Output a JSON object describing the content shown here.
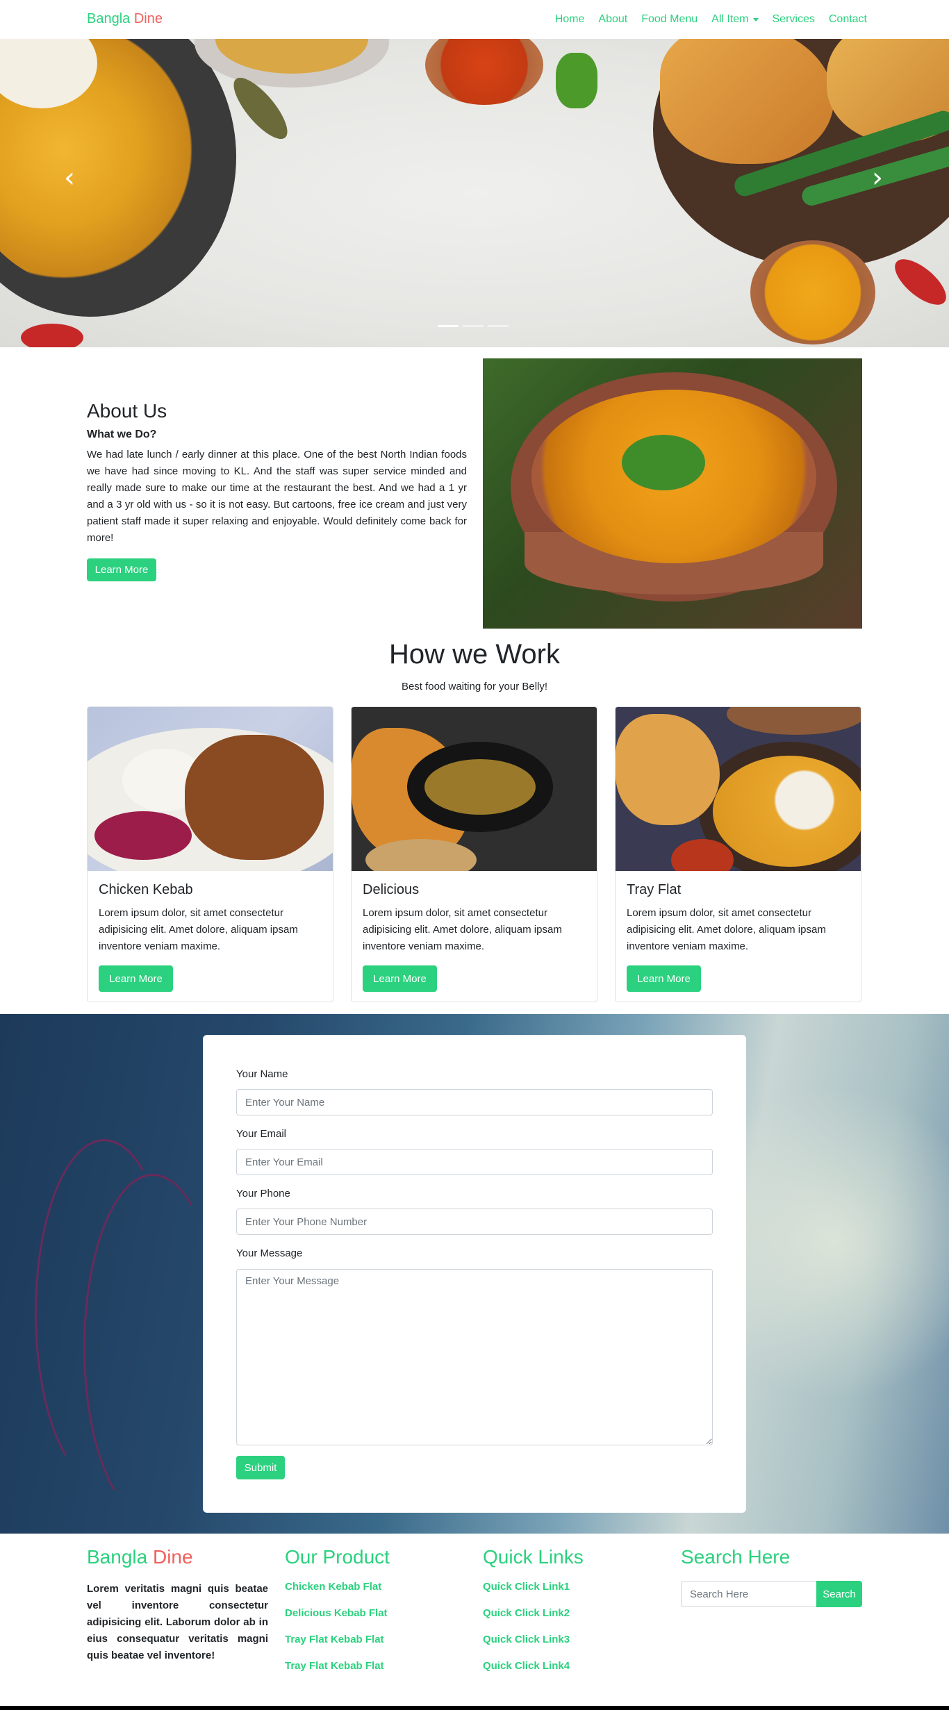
{
  "navbar": {
    "brand_part1": "Bangla",
    "brand_part2": "Dine",
    "items": [
      "Home",
      "About",
      "Food Menu",
      "All Item",
      "Services",
      "Contact"
    ]
  },
  "hero": {
    "prev_icon": "chevron-left-icon",
    "next_icon": "chevron-right-icon",
    "slide_count": 3,
    "active_slide": 1
  },
  "about": {
    "title": "About Us",
    "subtitle": "What we Do?",
    "text": "We had late lunch / early dinner at this place. One of the best North Indian foods we have had since moving to KL. And the staff was super service minded and really made sure to make our time at the restaurant the best. And we had a 1 yr and a 3 yr old with us - so it is not easy. But cartoons, free ice cream and just very patient staff made it super relaxing and enjoyable. Would definitely come back for more!",
    "button": "Learn More"
  },
  "how": {
    "title": "How we Work",
    "subtitle": "Best food waiting for your Belly!",
    "cards": [
      {
        "title": "Chicken Kebab",
        "text": "Lorem ipsum dolor, sit amet consectetur adipisicing elit. Amet dolore, aliquam ipsam inventore veniam maxime.",
        "button": "Learn More"
      },
      {
        "title": "Delicious",
        "text": "Lorem ipsum dolor, sit amet consectetur adipisicing elit. Amet dolore, aliquam ipsam inventore veniam maxime.",
        "button": "Learn More"
      },
      {
        "title": "Tray Flat",
        "text": "Lorem ipsum dolor, sit amet consectetur adipisicing elit. Amet dolore, aliquam ipsam inventore veniam maxime.",
        "button": "Learn More"
      }
    ]
  },
  "contact": {
    "name_label": "Your Name",
    "name_placeholder": "Enter Your Name",
    "email_label": "Your Email",
    "email_placeholder": "Enter Your Email",
    "phone_label": "Your Phone",
    "phone_placeholder": "Enter Your Phone Number",
    "message_label": "Your Message",
    "message_placeholder": "Enter Your Message",
    "submit": "Submit"
  },
  "footer": {
    "brand_part1": "Bangla",
    "brand_part2": "Dine",
    "text": "Lorem veritatis magni quis beatae vel inventore consectetur adipisicing elit. Laborum dolor ab in eius consequatur veritatis magni quis beatae vel inventore!",
    "product_title": "Our Product",
    "products": [
      "Chicken Kebab Flat",
      "Delicious Kebab Flat",
      "Tray Flat Kebab Flat",
      "Tray Flat Kebab Flat"
    ],
    "links_title": "Quick Links",
    "links": [
      "Quick Click Link1",
      "Quick Click Link2",
      "Quick Click Link3",
      "Quick Click Link4"
    ],
    "search_title": "Search Here",
    "search_placeholder": "Search Here",
    "search_button": "Search"
  },
  "colors": {
    "accent": "#2bd17e",
    "brand_red": "#f0605d"
  }
}
